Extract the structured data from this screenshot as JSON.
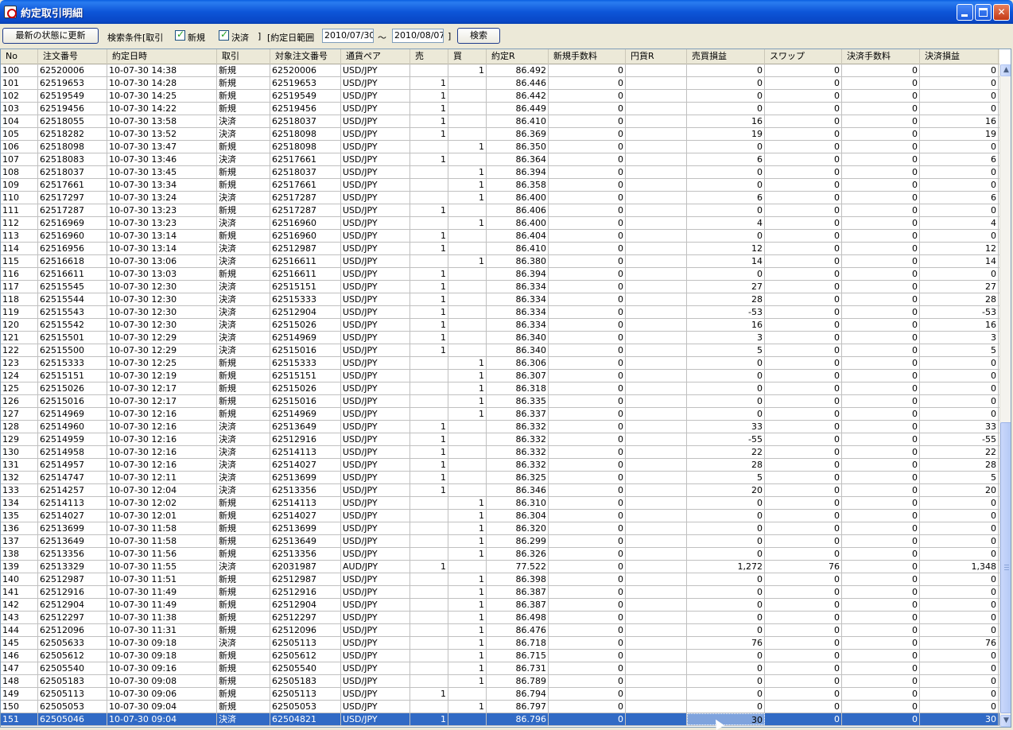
{
  "window": {
    "title": "約定取引明細"
  },
  "toolbar": {
    "refresh_label": "最新の状態に更新",
    "criteria_label": "検索条件[取引",
    "filter_new": {
      "label": "新規",
      "checked": true
    },
    "filter_settle": {
      "label": "決済",
      "checked": true
    },
    "bracket_close": "]",
    "date_range_label": "[約定日範囲",
    "date_from": "2010/07/30",
    "tilde": "〜",
    "date_to": "2010/08/07",
    "bracket_close2": "]",
    "search_label": "検索"
  },
  "table": {
    "columns": [
      "No",
      "注文番号",
      "約定日時",
      "取引",
      "対象注文番号",
      "通貨ペア",
      "売",
      "買",
      "約定R",
      "新規手数料",
      "円貨R",
      "売買損益",
      "スワップ",
      "決済手数料",
      "決済損益"
    ],
    "rows": [
      [
        "100",
        "62520006",
        "10-07-30 14:38",
        "新規",
        "62520006",
        "USD/JPY",
        "",
        "1",
        "86.492",
        "0",
        "",
        "0",
        "0",
        "0",
        "0"
      ],
      [
        "101",
        "62519653",
        "10-07-30 14:28",
        "新規",
        "62519653",
        "USD/JPY",
        "1",
        "",
        "86.446",
        "0",
        "",
        "0",
        "0",
        "0",
        "0"
      ],
      [
        "102",
        "62519549",
        "10-07-30 14:25",
        "新規",
        "62519549",
        "USD/JPY",
        "1",
        "",
        "86.442",
        "0",
        "",
        "0",
        "0",
        "0",
        "0"
      ],
      [
        "103",
        "62519456",
        "10-07-30 14:22",
        "新規",
        "62519456",
        "USD/JPY",
        "1",
        "",
        "86.449",
        "0",
        "",
        "0",
        "0",
        "0",
        "0"
      ],
      [
        "104",
        "62518055",
        "10-07-30 13:58",
        "決済",
        "62518037",
        "USD/JPY",
        "1",
        "",
        "86.410",
        "0",
        "",
        "16",
        "0",
        "0",
        "16"
      ],
      [
        "105",
        "62518282",
        "10-07-30 13:52",
        "決済",
        "62518098",
        "USD/JPY",
        "1",
        "",
        "86.369",
        "0",
        "",
        "19",
        "0",
        "0",
        "19"
      ],
      [
        "106",
        "62518098",
        "10-07-30 13:47",
        "新規",
        "62518098",
        "USD/JPY",
        "",
        "1",
        "86.350",
        "0",
        "",
        "0",
        "0",
        "0",
        "0"
      ],
      [
        "107",
        "62518083",
        "10-07-30 13:46",
        "決済",
        "62517661",
        "USD/JPY",
        "1",
        "",
        "86.364",
        "0",
        "",
        "6",
        "0",
        "0",
        "6"
      ],
      [
        "108",
        "62518037",
        "10-07-30 13:45",
        "新規",
        "62518037",
        "USD/JPY",
        "",
        "1",
        "86.394",
        "0",
        "",
        "0",
        "0",
        "0",
        "0"
      ],
      [
        "109",
        "62517661",
        "10-07-30 13:34",
        "新規",
        "62517661",
        "USD/JPY",
        "",
        "1",
        "86.358",
        "0",
        "",
        "0",
        "0",
        "0",
        "0"
      ],
      [
        "110",
        "62517297",
        "10-07-30 13:24",
        "決済",
        "62517287",
        "USD/JPY",
        "",
        "1",
        "86.400",
        "0",
        "",
        "6",
        "0",
        "0",
        "6"
      ],
      [
        "111",
        "62517287",
        "10-07-30 13:23",
        "新規",
        "62517287",
        "USD/JPY",
        "1",
        "",
        "86.406",
        "0",
        "",
        "0",
        "0",
        "0",
        "0"
      ],
      [
        "112",
        "62516969",
        "10-07-30 13:23",
        "決済",
        "62516960",
        "USD/JPY",
        "",
        "1",
        "86.400",
        "0",
        "",
        "4",
        "0",
        "0",
        "4"
      ],
      [
        "113",
        "62516960",
        "10-07-30 13:14",
        "新規",
        "62516960",
        "USD/JPY",
        "1",
        "",
        "86.404",
        "0",
        "",
        "0",
        "0",
        "0",
        "0"
      ],
      [
        "114",
        "62516956",
        "10-07-30 13:14",
        "決済",
        "62512987",
        "USD/JPY",
        "1",
        "",
        "86.410",
        "0",
        "",
        "12",
        "0",
        "0",
        "12"
      ],
      [
        "115",
        "62516618",
        "10-07-30 13:06",
        "決済",
        "62516611",
        "USD/JPY",
        "",
        "1",
        "86.380",
        "0",
        "",
        "14",
        "0",
        "0",
        "14"
      ],
      [
        "116",
        "62516611",
        "10-07-30 13:03",
        "新規",
        "62516611",
        "USD/JPY",
        "1",
        "",
        "86.394",
        "0",
        "",
        "0",
        "0",
        "0",
        "0"
      ],
      [
        "117",
        "62515545",
        "10-07-30 12:30",
        "決済",
        "62515151",
        "USD/JPY",
        "1",
        "",
        "86.334",
        "0",
        "",
        "27",
        "0",
        "0",
        "27"
      ],
      [
        "118",
        "62515544",
        "10-07-30 12:30",
        "決済",
        "62515333",
        "USD/JPY",
        "1",
        "",
        "86.334",
        "0",
        "",
        "28",
        "0",
        "0",
        "28"
      ],
      [
        "119",
        "62515543",
        "10-07-30 12:30",
        "決済",
        "62512904",
        "USD/JPY",
        "1",
        "",
        "86.334",
        "0",
        "",
        "-53",
        "0",
        "0",
        "-53"
      ],
      [
        "120",
        "62515542",
        "10-07-30 12:30",
        "決済",
        "62515026",
        "USD/JPY",
        "1",
        "",
        "86.334",
        "0",
        "",
        "16",
        "0",
        "0",
        "16"
      ],
      [
        "121",
        "62515501",
        "10-07-30 12:29",
        "決済",
        "62514969",
        "USD/JPY",
        "1",
        "",
        "86.340",
        "0",
        "",
        "3",
        "0",
        "0",
        "3"
      ],
      [
        "122",
        "62515500",
        "10-07-30 12:29",
        "決済",
        "62515016",
        "USD/JPY",
        "1",
        "",
        "86.340",
        "0",
        "",
        "5",
        "0",
        "0",
        "5"
      ],
      [
        "123",
        "62515333",
        "10-07-30 12:25",
        "新規",
        "62515333",
        "USD/JPY",
        "",
        "1",
        "86.306",
        "0",
        "",
        "0",
        "0",
        "0",
        "0"
      ],
      [
        "124",
        "62515151",
        "10-07-30 12:19",
        "新規",
        "62515151",
        "USD/JPY",
        "",
        "1",
        "86.307",
        "0",
        "",
        "0",
        "0",
        "0",
        "0"
      ],
      [
        "125",
        "62515026",
        "10-07-30 12:17",
        "新規",
        "62515026",
        "USD/JPY",
        "",
        "1",
        "86.318",
        "0",
        "",
        "0",
        "0",
        "0",
        "0"
      ],
      [
        "126",
        "62515016",
        "10-07-30 12:17",
        "新規",
        "62515016",
        "USD/JPY",
        "",
        "1",
        "86.335",
        "0",
        "",
        "0",
        "0",
        "0",
        "0"
      ],
      [
        "127",
        "62514969",
        "10-07-30 12:16",
        "新規",
        "62514969",
        "USD/JPY",
        "",
        "1",
        "86.337",
        "0",
        "",
        "0",
        "0",
        "0",
        "0"
      ],
      [
        "128",
        "62514960",
        "10-07-30 12:16",
        "決済",
        "62513649",
        "USD/JPY",
        "1",
        "",
        "86.332",
        "0",
        "",
        "33",
        "0",
        "0",
        "33"
      ],
      [
        "129",
        "62514959",
        "10-07-30 12:16",
        "決済",
        "62512916",
        "USD/JPY",
        "1",
        "",
        "86.332",
        "0",
        "",
        "-55",
        "0",
        "0",
        "-55"
      ],
      [
        "130",
        "62514958",
        "10-07-30 12:16",
        "決済",
        "62514113",
        "USD/JPY",
        "1",
        "",
        "86.332",
        "0",
        "",
        "22",
        "0",
        "0",
        "22"
      ],
      [
        "131",
        "62514957",
        "10-07-30 12:16",
        "決済",
        "62514027",
        "USD/JPY",
        "1",
        "",
        "86.332",
        "0",
        "",
        "28",
        "0",
        "0",
        "28"
      ],
      [
        "132",
        "62514747",
        "10-07-30 12:11",
        "決済",
        "62513699",
        "USD/JPY",
        "1",
        "",
        "86.325",
        "0",
        "",
        "5",
        "0",
        "0",
        "5"
      ],
      [
        "133",
        "62514257",
        "10-07-30 12:04",
        "決済",
        "62513356",
        "USD/JPY",
        "1",
        "",
        "86.346",
        "0",
        "",
        "20",
        "0",
        "0",
        "20"
      ],
      [
        "134",
        "62514113",
        "10-07-30 12:02",
        "新規",
        "62514113",
        "USD/JPY",
        "",
        "1",
        "86.310",
        "0",
        "",
        "0",
        "0",
        "0",
        "0"
      ],
      [
        "135",
        "62514027",
        "10-07-30 12:01",
        "新規",
        "62514027",
        "USD/JPY",
        "",
        "1",
        "86.304",
        "0",
        "",
        "0",
        "0",
        "0",
        "0"
      ],
      [
        "136",
        "62513699",
        "10-07-30 11:58",
        "新規",
        "62513699",
        "USD/JPY",
        "",
        "1",
        "86.320",
        "0",
        "",
        "0",
        "0",
        "0",
        "0"
      ],
      [
        "137",
        "62513649",
        "10-07-30 11:58",
        "新規",
        "62513649",
        "USD/JPY",
        "",
        "1",
        "86.299",
        "0",
        "",
        "0",
        "0",
        "0",
        "0"
      ],
      [
        "138",
        "62513356",
        "10-07-30 11:56",
        "新規",
        "62513356",
        "USD/JPY",
        "",
        "1",
        "86.326",
        "0",
        "",
        "0",
        "0",
        "0",
        "0"
      ],
      [
        "139",
        "62513329",
        "10-07-30 11:55",
        "決済",
        "62031987",
        "AUD/JPY",
        "1",
        "",
        "77.522",
        "0",
        "",
        "1,272",
        "76",
        "0",
        "1,348"
      ],
      [
        "140",
        "62512987",
        "10-07-30 11:51",
        "新規",
        "62512987",
        "USD/JPY",
        "",
        "1",
        "86.398",
        "0",
        "",
        "0",
        "0",
        "0",
        "0"
      ],
      [
        "141",
        "62512916",
        "10-07-30 11:49",
        "新規",
        "62512916",
        "USD/JPY",
        "",
        "1",
        "86.387",
        "0",
        "",
        "0",
        "0",
        "0",
        "0"
      ],
      [
        "142",
        "62512904",
        "10-07-30 11:49",
        "新規",
        "62512904",
        "USD/JPY",
        "",
        "1",
        "86.387",
        "0",
        "",
        "0",
        "0",
        "0",
        "0"
      ],
      [
        "143",
        "62512297",
        "10-07-30 11:38",
        "新規",
        "62512297",
        "USD/JPY",
        "",
        "1",
        "86.498",
        "0",
        "",
        "0",
        "0",
        "0",
        "0"
      ],
      [
        "144",
        "62512096",
        "10-07-30 11:31",
        "新規",
        "62512096",
        "USD/JPY",
        "",
        "1",
        "86.476",
        "0",
        "",
        "0",
        "0",
        "0",
        "0"
      ],
      [
        "145",
        "62505633",
        "10-07-30 09:18",
        "決済",
        "62505113",
        "USD/JPY",
        "",
        "1",
        "86.718",
        "0",
        "",
        "76",
        "0",
        "0",
        "76"
      ],
      [
        "146",
        "62505612",
        "10-07-30 09:18",
        "新規",
        "62505612",
        "USD/JPY",
        "",
        "1",
        "86.715",
        "0",
        "",
        "0",
        "0",
        "0",
        "0"
      ],
      [
        "147",
        "62505540",
        "10-07-30 09:16",
        "新規",
        "62505540",
        "USD/JPY",
        "",
        "1",
        "86.731",
        "0",
        "",
        "0",
        "0",
        "0",
        "0"
      ],
      [
        "148",
        "62505183",
        "10-07-30 09:08",
        "新規",
        "62505183",
        "USD/JPY",
        "",
        "1",
        "86.789",
        "0",
        "",
        "0",
        "0",
        "0",
        "0"
      ],
      [
        "149",
        "62505113",
        "10-07-30 09:06",
        "新規",
        "62505113",
        "USD/JPY",
        "1",
        "",
        "86.794",
        "0",
        "",
        "0",
        "0",
        "0",
        "0"
      ],
      [
        "150",
        "62505053",
        "10-07-30 09:04",
        "新規",
        "62505053",
        "USD/JPY",
        "",
        "1",
        "86.797",
        "0",
        "",
        "0",
        "0",
        "0",
        "0"
      ],
      [
        "151",
        "62505046",
        "10-07-30 09:04",
        "決済",
        "62504821",
        "USD/JPY",
        "1",
        "",
        "86.796",
        "0",
        "",
        "30",
        "0",
        "0",
        "30"
      ]
    ],
    "selected_row_index": 51,
    "focused_column_index": 11
  },
  "icons": {
    "app": "app-icon",
    "minimize": "minimize-icon",
    "maximize": "maximize-icon",
    "close": "close-icon",
    "scroll_up": "scroll-up-arrow-icon",
    "scroll_down": "scroll-down-arrow-icon"
  },
  "colors": {
    "titlebar": "#0d55d8",
    "selection": "#316ac5",
    "checkmark": "#21a121"
  }
}
